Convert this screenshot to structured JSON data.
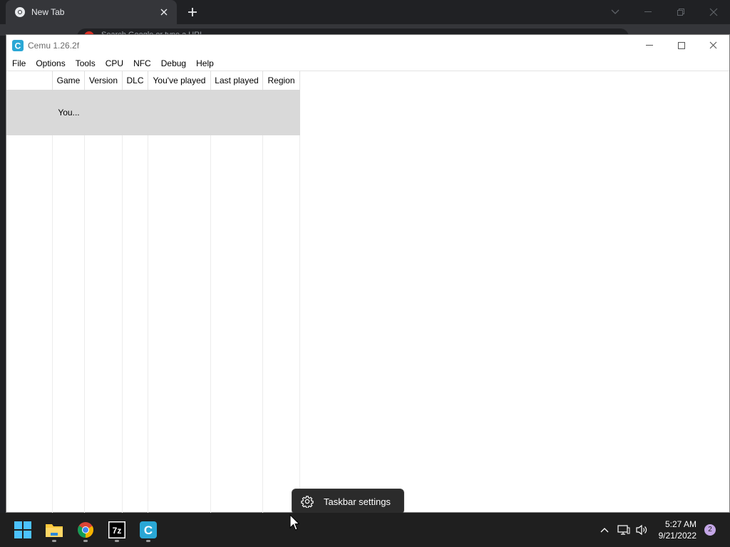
{
  "browser": {
    "tab_title": "New Tab",
    "omnibox_text": "Search Google or type a URL"
  },
  "cemu": {
    "title": "Cemu 1.26.2f",
    "menu": [
      "File",
      "Options",
      "Tools",
      "CPU",
      "NFC",
      "Debug",
      "Help"
    ],
    "columns": [
      "",
      "Game",
      "Version",
      "DLC",
      "You've played",
      "Last played",
      "Region"
    ],
    "rows": [
      {
        "game": "You..."
      }
    ]
  },
  "tooltip": {
    "label": "Taskbar settings"
  },
  "taskbar": {
    "apps": [
      "start",
      "file-explorer",
      "chrome",
      "7-zip",
      "cemu"
    ],
    "time": "5:27 AM",
    "date": "9/21/2022",
    "notification_count": "2"
  }
}
